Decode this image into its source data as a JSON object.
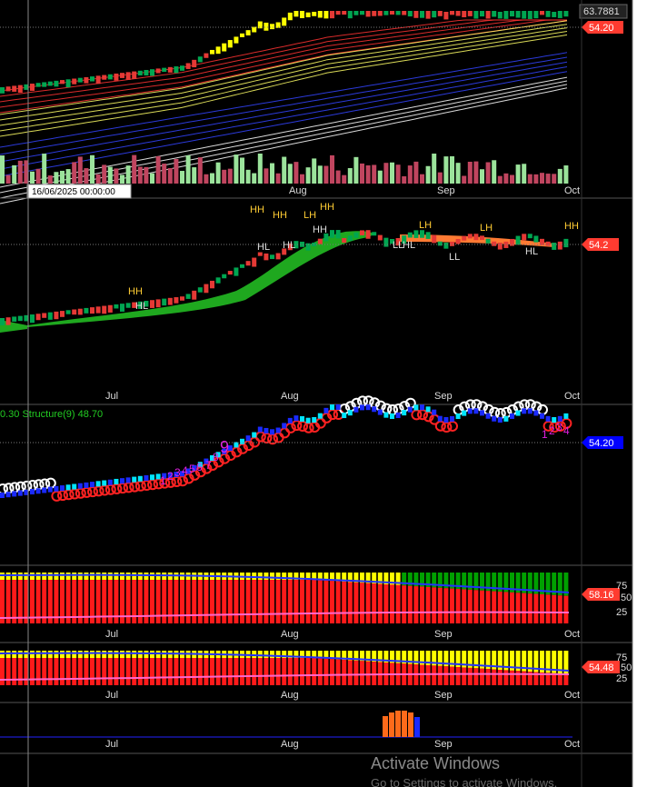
{
  "panels": {
    "price": {
      "last_price_top": "63.7881",
      "last_price_tag": "54.20",
      "date_tooltip": "16/06/2025 00:00:00",
      "x_ticks": [
        "Aug",
        "Sep",
        "Oct"
      ]
    },
    "structure_chart": {
      "last_price_tag": "54.2",
      "x_ticks": [
        "Jul",
        "Aug",
        "Sep",
        "Oct"
      ],
      "swing_labels": [
        "HH",
        "HH",
        "HH",
        "LH",
        "HH",
        "HL",
        "HL",
        "HL",
        "HH",
        "HL",
        "LH",
        "LH",
        "LL",
        "LL",
        "HL",
        "HH"
      ]
    },
    "demark": {
      "header": "0.30 Structure(9) 48.70",
      "last_price_tag": "54.20",
      "count_labels": [
        "1",
        "2",
        "3",
        "4",
        "5",
        "6",
        "7",
        "8",
        "9",
        "1",
        "2",
        "3",
        "4"
      ]
    },
    "oscillator_a": {
      "value_tag": "58.16",
      "levels": [
        "75",
        "50",
        "25"
      ],
      "x_ticks": [
        "Jul",
        "Aug",
        "Sep",
        "Oct"
      ]
    },
    "oscillator_b": {
      "value_tag": "54.48",
      "levels": [
        "75",
        "50",
        "25"
      ],
      "x_ticks": [
        "Jul",
        "Aug",
        "Sep",
        "Oct"
      ]
    },
    "histogram": {
      "x_ticks": [
        "Jul",
        "Aug",
        "Sep",
        "Oct"
      ]
    }
  },
  "watermark": {
    "title": "Activate Windows",
    "subtitle": "Go to Settings to activate Windows."
  },
  "colors": {
    "background": "#000000",
    "up_candle": "#00a651",
    "down_candle": "#e53935",
    "highlight": "#ffff00",
    "cloud": "#22bb22",
    "price_tag": "#ff3b30",
    "structure_tag": "#0000ff"
  }
}
